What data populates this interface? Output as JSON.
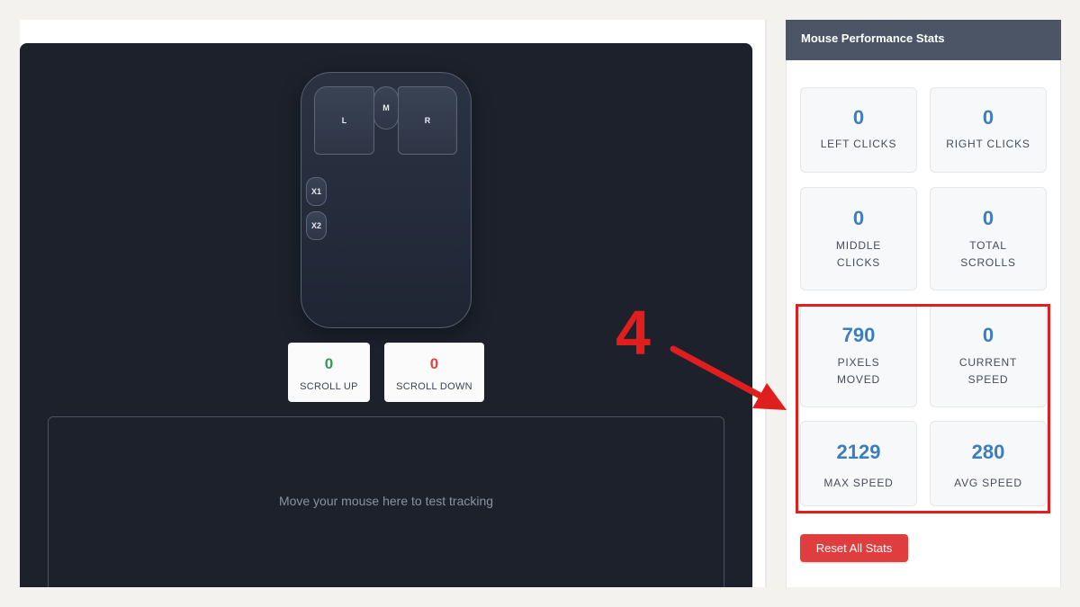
{
  "mouse": {
    "left": "L",
    "middle": "M",
    "right": "R",
    "x1": "X1",
    "x2": "X2"
  },
  "scroll": {
    "up_value": "0",
    "up_label": "SCROLL UP",
    "down_value": "0",
    "down_label": "SCROLL DOWN"
  },
  "tracking": {
    "prompt": "Move your mouse here to test tracking"
  },
  "sidebar": {
    "title": "Mouse Performance Stats",
    "stats": [
      {
        "value": "0",
        "label": "LEFT CLICKS"
      },
      {
        "value": "0",
        "label": "RIGHT CLICKS"
      },
      {
        "value": "0",
        "label": "MIDDLE CLICKS"
      },
      {
        "value": "0",
        "label": "TOTAL SCROLLS"
      },
      {
        "value": "790",
        "label": "PIXELS MOVED"
      },
      {
        "value": "0",
        "label": "CURRENT SPEED"
      },
      {
        "value": "2129",
        "label": "MAX SPEED"
      },
      {
        "value": "280",
        "label": "AVG SPEED"
      }
    ],
    "reset_label": "Reset All Stats"
  },
  "annotation": {
    "number": "4",
    "color": "#e01e1e"
  },
  "colors": {
    "stat_value": "#3a7ec0",
    "scroll_up": "#2f9e5a",
    "scroll_down": "#e04444",
    "reset": "#e03e3e",
    "header": "#4b5566",
    "dark_panel": "#1c212c"
  }
}
